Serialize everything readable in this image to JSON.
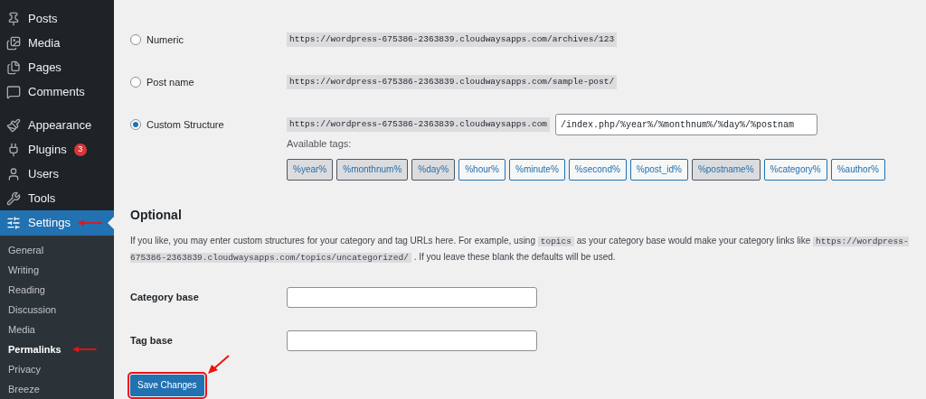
{
  "sidebar": {
    "items": [
      {
        "label": "Posts",
        "selected": false
      },
      {
        "label": "Media",
        "selected": false
      },
      {
        "label": "Pages",
        "selected": false
      },
      {
        "label": "Comments",
        "selected": false
      },
      {
        "label": "Appearance",
        "selected": false
      },
      {
        "label": "Plugins",
        "selected": false,
        "badge": "3"
      },
      {
        "label": "Users",
        "selected": false
      },
      {
        "label": "Tools",
        "selected": false
      },
      {
        "label": "Settings",
        "selected": true
      }
    ],
    "submenu": [
      {
        "label": "General",
        "selected": false
      },
      {
        "label": "Writing",
        "selected": false
      },
      {
        "label": "Reading",
        "selected": false
      },
      {
        "label": "Discussion",
        "selected": false
      },
      {
        "label": "Media",
        "selected": false
      },
      {
        "label": "Permalinks",
        "selected": true
      },
      {
        "label": "Privacy",
        "selected": false
      },
      {
        "label": "Breeze",
        "selected": false
      }
    ]
  },
  "permalink_options": [
    {
      "label": "Numeric",
      "selected": false,
      "example": "https://wordpress-675386-2363839.cloudwaysapps.com/archives/123"
    },
    {
      "label": "Post name",
      "selected": false,
      "example": "https://wordpress-675386-2363839.cloudwaysapps.com/sample-post/"
    },
    {
      "label": "Custom Structure",
      "selected": true,
      "example": "https://wordpress-675386-2363839.cloudwaysapps.com",
      "value": "/index.php/%year%/%monthnum%/%day%/%postnam"
    }
  ],
  "available_tags": {
    "label": "Available tags:",
    "tags": [
      {
        "label": "%year%",
        "selected": true
      },
      {
        "label": "%monthnum%",
        "selected": true
      },
      {
        "label": "%day%",
        "selected": true
      },
      {
        "label": "%hour%",
        "selected": false
      },
      {
        "label": "%minute%",
        "selected": false
      },
      {
        "label": "%second%",
        "selected": false
      },
      {
        "label": "%post_id%",
        "selected": false
      },
      {
        "label": "%postname%",
        "selected": true
      },
      {
        "label": "%category%",
        "selected": false
      },
      {
        "label": "%author%",
        "selected": false
      }
    ]
  },
  "optional": {
    "heading": "Optional",
    "description": [
      {
        "kind": "text",
        "text": "If you like, you may enter custom structures for your category and tag URLs here. For example, using "
      },
      {
        "kind": "code",
        "text": "topics"
      },
      {
        "kind": "text",
        "text": " as your category base would make your category links like "
      },
      {
        "kind": "code",
        "text": "https://wordpress-675386-2363839.cloudwaysapps.com/topics/uncategorized/"
      },
      {
        "kind": "text",
        "text": " . If you leave these blank the defaults will be used."
      }
    ],
    "fields": [
      {
        "label": "Category base"
      },
      {
        "label": "Tag base"
      }
    ]
  },
  "save_button": {
    "label": "Save Changes"
  }
}
